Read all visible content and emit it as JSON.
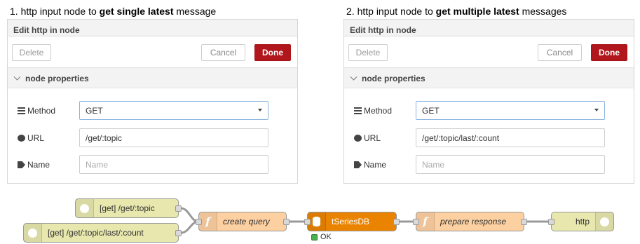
{
  "captions": [
    {
      "number": "1.",
      "pre": "http input node to ",
      "bold": "get single latest",
      "post": " message"
    },
    {
      "number": "2.",
      "pre": "http input node to ",
      "bold": "get multiple latest",
      "post": " messages"
    }
  ],
  "panels": [
    {
      "title": "Edit http in node",
      "delete_label": "Delete",
      "cancel_label": "Cancel",
      "done_label": "Done",
      "section_label": "node properties",
      "method_label": "Method",
      "method_value": "GET",
      "url_label": "URL",
      "url_value": "/get/:topic",
      "name_label": "Name",
      "name_placeholder": "Name"
    },
    {
      "title": "Edit http in node",
      "delete_label": "Delete",
      "cancel_label": "Cancel",
      "done_label": "Done",
      "section_label": "node properties",
      "method_label": "Method",
      "method_value": "GET",
      "url_label": "URL",
      "url_value": "/get/:topic/last/:count",
      "name_label": "Name",
      "name_placeholder": "Name"
    }
  ],
  "flow": {
    "http_in_1": "[get] /get/:topic",
    "http_in_2": "[get] /get/:topic/last/:count",
    "create_query": "create query",
    "db": "tSeriesDB",
    "db_status": "OK",
    "prepare_response": "prepare response",
    "http_out": "http",
    "colors": {
      "http": "#e7e7ae",
      "function": "#fdd0a2",
      "db": "#e98300",
      "done": "#b0161b",
      "status_ok": "#4caf50"
    }
  }
}
